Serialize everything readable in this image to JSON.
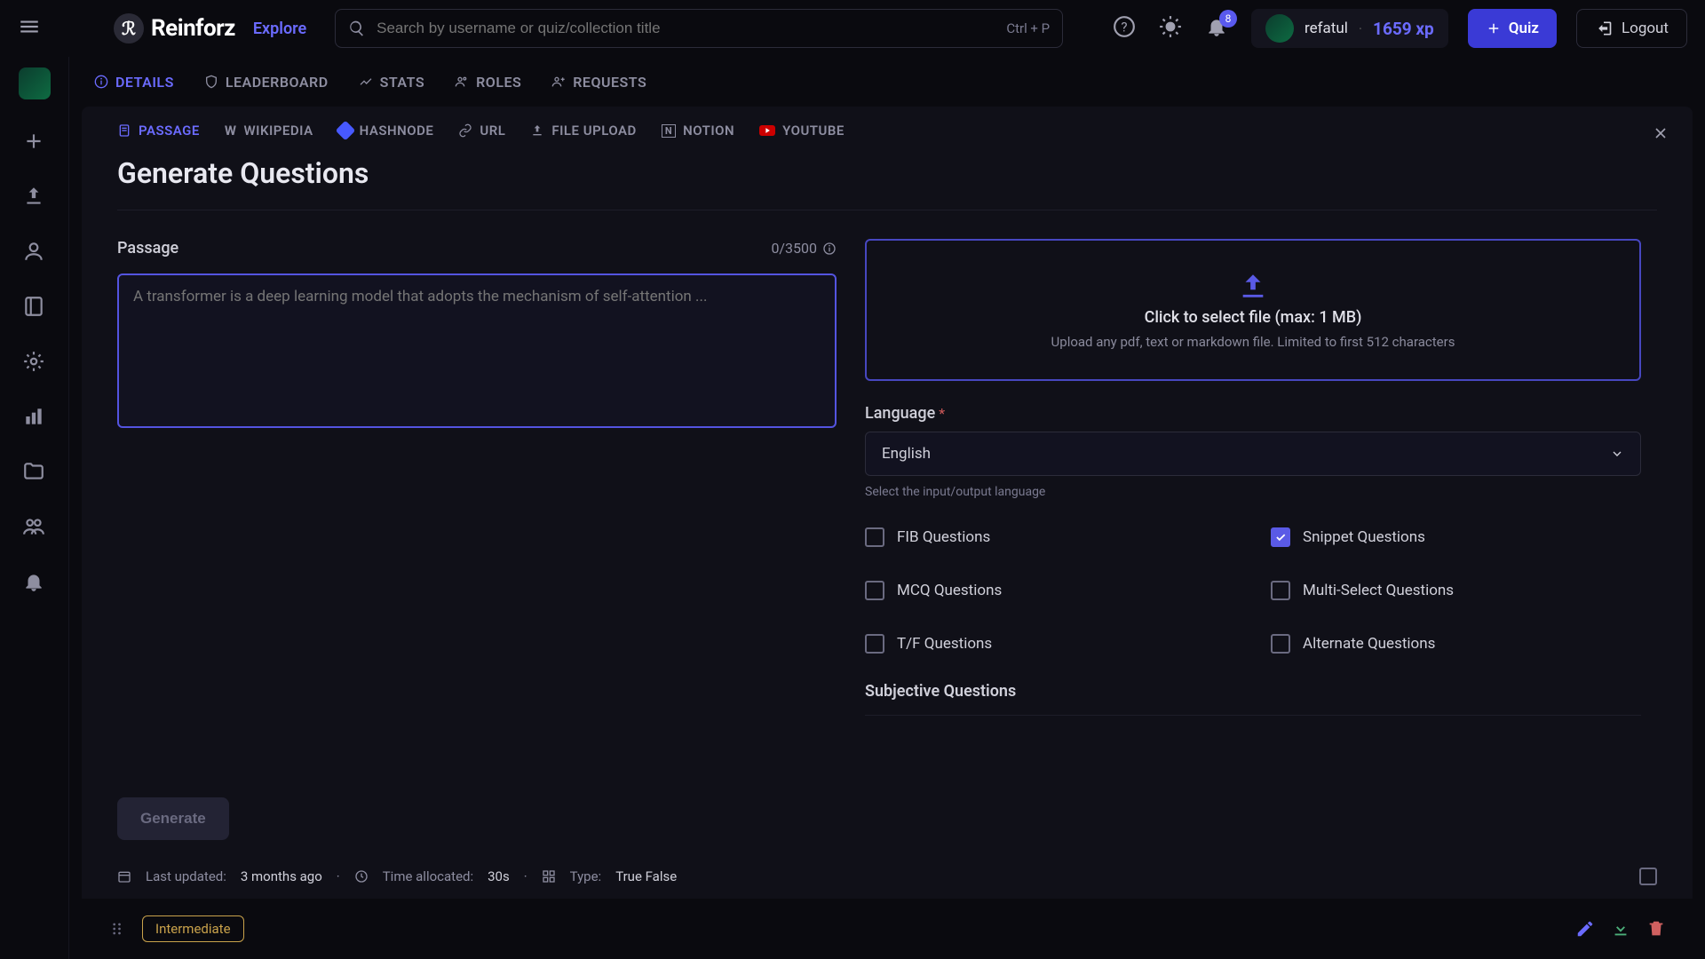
{
  "topbar": {
    "brand": "Reinforz",
    "explore": "Explore",
    "search_placeholder": "Search by username or quiz/collection title",
    "shortcut": "Ctrl + P",
    "notif_count": "8",
    "username": "refatul",
    "xp": "1659 xp",
    "quiz_btn": "Quiz",
    "logout_btn": "Logout"
  },
  "nav_tabs": {
    "details": "DETAILS",
    "leaderboard": "LEADERBOARD",
    "stats": "STATS",
    "roles": "ROLES",
    "requests": "REQUESTS"
  },
  "source_tabs": {
    "passage": "PASSAGE",
    "wikipedia": "WIKIPEDIA",
    "hashnode": "HASHNODE",
    "url": "URL",
    "file_upload": "FILE UPLOAD",
    "notion": "NOTION",
    "youtube": "YOUTUBE"
  },
  "heading": "Generate Questions",
  "passage": {
    "label": "Passage",
    "counter": "0/3500",
    "placeholder": "A transformer is a deep learning model that adopts the mechanism of self-attention ..."
  },
  "dropzone": {
    "main": "Click to select file (max: 1 MB)",
    "sub": "Upload any pdf, text or markdown file. Limited to first 512 characters"
  },
  "language": {
    "label": "Language",
    "value": "English",
    "helper": "Select the input/output language"
  },
  "checks": {
    "fib": "FIB Questions",
    "snippet": "Snippet Questions",
    "mcq": "MCQ Questions",
    "multi": "Multi-Select Questions",
    "tf": "T/F Questions",
    "alternate": "Alternate Questions"
  },
  "subjective_heading": "Subjective Questions",
  "generate_btn": "Generate",
  "meta": {
    "last_updated_label": "Last updated:",
    "last_updated_value": "3 months ago",
    "time_label": "Time allocated:",
    "time_value": "30s",
    "type_label": "Type:",
    "type_value": "True False"
  },
  "footer": {
    "difficulty": "Intermediate"
  }
}
